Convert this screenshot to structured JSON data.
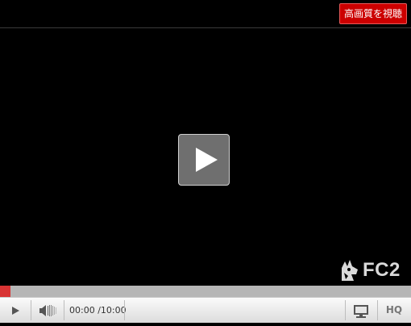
{
  "header": {
    "hq_watch_label": "高画質を視聴"
  },
  "video": {
    "progress": 0.025
  },
  "logo": {
    "text": "FC2"
  },
  "controls": {
    "current_time": "00:00",
    "duration": "/10:00",
    "hq_label": "HQ"
  },
  "icons": {
    "play_overlay": "play-icon",
    "play": "play-icon",
    "volume": "volume-icon",
    "screen": "monitor-icon"
  },
  "colors": {
    "accent_red": "#cc0000",
    "progress_red": "#d83434",
    "logo_gray": "#d9d9d9"
  }
}
